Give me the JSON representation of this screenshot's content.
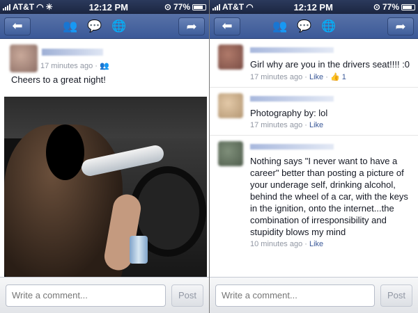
{
  "left": {
    "status": {
      "carrier": "AT&T",
      "time": "12:12 PM",
      "battery": "77%"
    },
    "post": {
      "meta": "17 minutes ago · ",
      "audience_icon": "friends-icon",
      "text": "Cheers to a great night!"
    },
    "composer": {
      "placeholder": "Write a comment...",
      "post_label": "Post"
    }
  },
  "right": {
    "status": {
      "carrier": "AT&T",
      "time": "12:12 PM",
      "battery": "77%"
    },
    "comments": [
      {
        "text": "Girl why are you in the drivers seat!!!! :0",
        "time": "17 minutes ago",
        "like": "Like",
        "likes": "1"
      },
      {
        "text": "Photography by: lol",
        "time": "17 minutes ago",
        "like": "Like"
      },
      {
        "text": "Nothing says \"I never want to have a career\" better than posting a picture of your underage self, drinking alcohol, behind the wheel of a car, with the keys in the ignition, onto the internet...the combination of irresponsibility and stupidity blows my mind",
        "time": "10 minutes ago",
        "like": "Like"
      }
    ],
    "composer": {
      "placeholder": "Write a comment...",
      "post_label": "Post"
    }
  },
  "icons": {
    "back": "back-arrow-icon",
    "friends": "friend-requests-icon",
    "messages": "messages-icon",
    "notifications": "notifications-icon",
    "share": "share-icon"
  },
  "colors": {
    "facebook_blue": "#3b5998",
    "navbar": "#4e69a2"
  }
}
